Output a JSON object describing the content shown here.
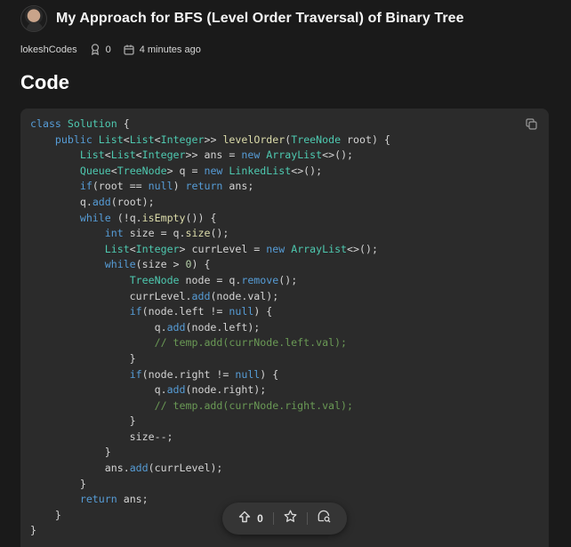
{
  "post": {
    "title": "My Approach for BFS (Level Order Traversal) of Binary Tree",
    "author": "lokeshCodes",
    "votes": "0",
    "time": "4 minutes ago"
  },
  "section": {
    "title": "Code"
  },
  "code_lines": [
    [
      [
        "kw",
        "class"
      ],
      [
        "",
        "",
        " "
      ],
      [
        "ty",
        "Solution"
      ],
      [
        "",
        " {"
      ]
    ],
    [
      [
        "",
        "    "
      ],
      [
        "kw",
        "public"
      ],
      [
        "",
        " "
      ],
      [
        "ty",
        "List"
      ],
      [
        "",
        "<"
      ],
      [
        "ty",
        "List"
      ],
      [
        "",
        "<"
      ],
      [
        "ty",
        "Integer"
      ],
      [
        "",
        ">> "
      ],
      [
        "fn",
        "levelOrder"
      ],
      [
        "",
        "("
      ],
      [
        "ty",
        "TreeNode"
      ],
      [
        "",
        " root) {"
      ]
    ],
    [
      [
        "",
        "        "
      ],
      [
        "ty",
        "List"
      ],
      [
        "",
        "<"
      ],
      [
        "ty",
        "List"
      ],
      [
        "",
        "<"
      ],
      [
        "ty",
        "Integer"
      ],
      [
        "",
        ">> ans = "
      ],
      [
        "kw",
        "new"
      ],
      [
        "",
        " "
      ],
      [
        "ty",
        "ArrayList"
      ],
      [
        "",
        "<>();"
      ]
    ],
    [
      [
        "",
        "        "
      ],
      [
        "ty",
        "Queue"
      ],
      [
        "",
        "<"
      ],
      [
        "ty",
        "TreeNode"
      ],
      [
        "",
        "> q = "
      ],
      [
        "kw",
        "new"
      ],
      [
        "",
        " "
      ],
      [
        "ty",
        "LinkedList"
      ],
      [
        "",
        "<>();"
      ]
    ],
    [
      [
        "",
        "        "
      ],
      [
        "kw",
        "if"
      ],
      [
        "",
        "(root == "
      ],
      [
        "kw",
        "null"
      ],
      [
        "",
        ") "
      ],
      [
        "kw",
        "return"
      ],
      [
        "",
        " ans;"
      ]
    ],
    [
      [
        "",
        "        q."
      ],
      [
        "md",
        "add"
      ],
      [
        "",
        "(root);"
      ]
    ],
    [
      [
        "",
        "        "
      ],
      [
        "kw",
        "while"
      ],
      [
        "",
        " (!q."
      ],
      [
        "fn",
        "isEmpty"
      ],
      [
        "",
        "()) {"
      ]
    ],
    [
      [
        "",
        "            "
      ],
      [
        "kw",
        "int"
      ],
      [
        "",
        " size = q."
      ],
      [
        "fn",
        "size"
      ],
      [
        "",
        "();"
      ]
    ],
    [
      [
        "",
        "            "
      ],
      [
        "ty",
        "List"
      ],
      [
        "",
        "<"
      ],
      [
        "ty",
        "Integer"
      ],
      [
        "",
        "> currLevel = "
      ],
      [
        "kw",
        "new"
      ],
      [
        "",
        " "
      ],
      [
        "ty",
        "ArrayList"
      ],
      [
        "",
        "<>();"
      ]
    ],
    [
      [
        "",
        "            "
      ],
      [
        "kw",
        "while"
      ],
      [
        "",
        "(size > "
      ],
      [
        "nm",
        "0"
      ],
      [
        "",
        ") {"
      ]
    ],
    [
      [
        "",
        "                "
      ],
      [
        "ty",
        "TreeNode"
      ],
      [
        "",
        " node = q."
      ],
      [
        "md",
        "remove"
      ],
      [
        "",
        "();"
      ]
    ],
    [
      [
        "",
        "                currLevel."
      ],
      [
        "md",
        "add"
      ],
      [
        "",
        "(node.val);"
      ]
    ],
    [
      [
        "",
        "                "
      ],
      [
        "kw",
        "if"
      ],
      [
        "",
        "(node.left != "
      ],
      [
        "kw",
        "null"
      ],
      [
        "",
        ") {"
      ]
    ],
    [
      [
        "",
        "                    q."
      ],
      [
        "md",
        "add"
      ],
      [
        "",
        "(node.left);"
      ]
    ],
    [
      [
        "",
        "                    "
      ],
      [
        "cm",
        "// temp.add(currNode.left.val);"
      ]
    ],
    [
      [
        "",
        "                }"
      ]
    ],
    [
      [
        "",
        "                "
      ],
      [
        "kw",
        "if"
      ],
      [
        "",
        "(node.right != "
      ],
      [
        "kw",
        "null"
      ],
      [
        "",
        ") {"
      ]
    ],
    [
      [
        "",
        "                    q."
      ],
      [
        "md",
        "add"
      ],
      [
        "",
        "(node.right);"
      ]
    ],
    [
      [
        "",
        "                    "
      ],
      [
        "cm",
        "// temp.add(currNode.right.val);"
      ]
    ],
    [
      [
        "",
        "                }"
      ]
    ],
    [
      [
        "",
        "                size--;"
      ]
    ],
    [
      [
        "",
        "            }"
      ]
    ],
    [
      [
        "",
        "            ans."
      ],
      [
        "md",
        "add"
      ],
      [
        "",
        "(currLevel);"
      ]
    ],
    [
      [
        "",
        "        }"
      ]
    ],
    [
      [
        "",
        "        "
      ],
      [
        "kw",
        "return"
      ],
      [
        "",
        " ans;"
      ]
    ],
    [
      [
        "",
        "    }"
      ]
    ],
    [
      [
        "",
        "}"
      ]
    ]
  ],
  "toolbar": {
    "upvotes": "0"
  },
  "icons": {
    "upvote": "arrow-up-icon",
    "favorite": "star-icon",
    "comment": "comment-search-icon",
    "copy": "copy-icon",
    "ranking": "award-icon",
    "date": "calendar-icon"
  }
}
